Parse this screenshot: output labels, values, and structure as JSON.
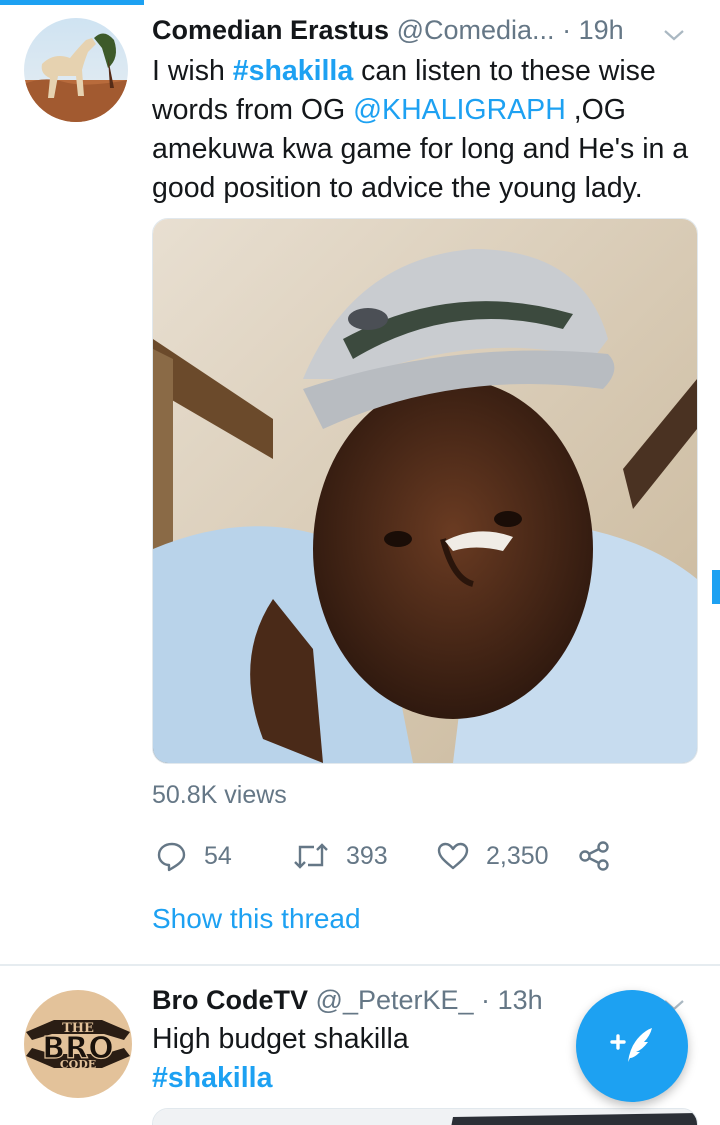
{
  "tweets": [
    {
      "name": "Comedian Erastus",
      "handle": "@Comedia...",
      "separator": "·",
      "time": "19h",
      "text_parts": {
        "p1": "I wish ",
        "hashtag": "#shakilla",
        "p2": " can listen to these wise words from OG ",
        "mention": "@KHALIGRAPH",
        "p3": " ,OG amekuwa kwa game for long and He's in a good position to advice the young lady."
      },
      "views": "50.8K views",
      "replies": "54",
      "retweets": "393",
      "likes": "2,350",
      "show_thread": "Show this thread"
    },
    {
      "name": "Bro CodeTV",
      "handle": "@_PeterKE_",
      "separator": "·",
      "time": "13h",
      "text": "High budget shakilla",
      "hashtag": "#shakilla",
      "avatar_text": {
        "top": "THE",
        "middle": "BRO",
        "bottom": "CODE"
      }
    }
  ],
  "icons": {
    "reply": "reply-icon",
    "retweet": "retweet-icon",
    "like": "heart-icon",
    "share": "share-icon",
    "caret": "chevron-down-icon",
    "compose": "compose-tweet-icon"
  },
  "colors": {
    "accent": "#1da1f2",
    "text": "#14171a",
    "secondary": "#657786"
  }
}
